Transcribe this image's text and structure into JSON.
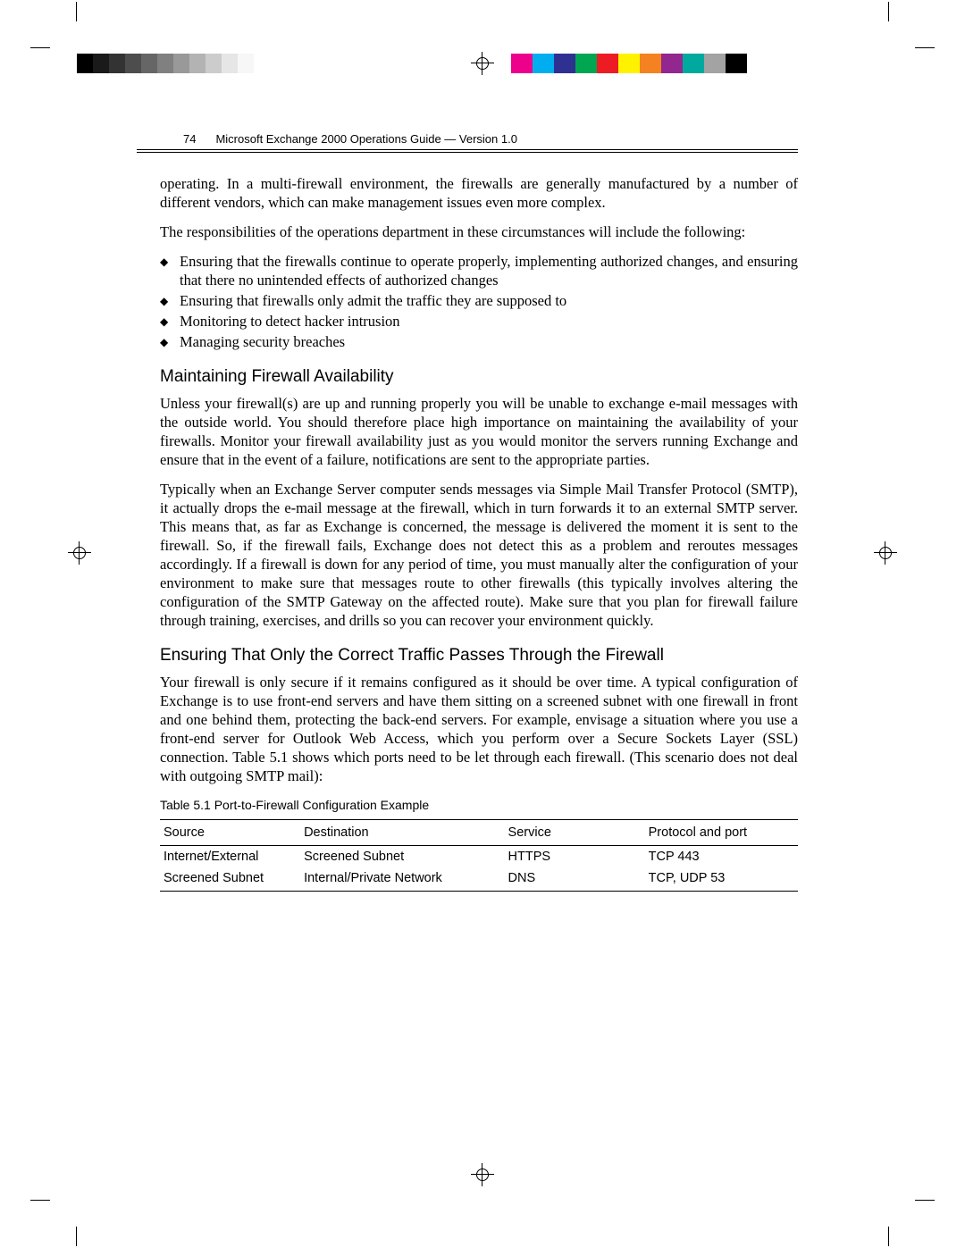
{
  "header": {
    "page_number": "74",
    "title": "Microsoft Exchange 2000 Operations Guide — Version 1.0"
  },
  "paragraphs": {
    "p1": "operating. In a multi-firewall environment, the firewalls are generally manufactured by a number of different vendors, which can make management issues even more complex.",
    "p2": "The responsibilities of the operations department in these circumstances will include the following:",
    "p3": "Unless your firewall(s) are up and running properly you will be unable to exchange e-mail messages with the outside world. You should therefore place high importance on maintaining the availability of your firewalls. Monitor your firewall availability just as you would monitor the servers running Exchange and ensure that in the event of a failure, notifications are sent to the appropriate parties.",
    "p4": "Typically when an Exchange Server computer sends messages via Simple Mail Transfer Protocol (SMTP), it actually drops the e-mail message at the firewall, which in turn forwards it to an external SMTP server. This means that, as far as Exchange is concerned, the message is delivered the moment it is sent to the firewall. So, if the firewall fails, Exchange does not detect this as a problem and reroutes messages accordingly. If a firewall is down for any period of time, you must manually alter the configuration of your environment to make sure that messages route to other firewalls (this typically involves altering the configuration of the SMTP Gateway on the affected route). Make sure that you plan for firewall failure through training, exercises, and drills so you can recover your environment quickly.",
    "p5": "Your firewall is only secure if it remains configured as it should be over time. A typical configuration of Exchange is to use front-end servers and have them sitting on a screened subnet with one firewall in front and one behind them, protecting the back-end servers. For example, envisage a situation where you use a front-end server for Outlook Web Access, which you perform over a Secure Sockets Layer (SSL) connection. Table 5.1 shows which ports need to be let through each firewall. (This scenario does not deal with outgoing SMTP mail):"
  },
  "bullets": [
    "Ensuring that the firewalls continue to operate properly, implementing authorized changes, and ensuring that there no unintended effects of authorized changes",
    "Ensuring that firewalls only admit the traffic they are supposed to",
    "Monitoring to detect hacker intrusion",
    "Managing security breaches"
  ],
  "headings": {
    "h1": "Maintaining Firewall Availability",
    "h2": "Ensuring That Only the Correct Traffic Passes Through the Firewall"
  },
  "table": {
    "caption": "Table 5.1  Port-to-Firewall Configuration Example",
    "columns": [
      "Source",
      "Destination",
      "Service",
      "Protocol and port"
    ],
    "rows": [
      [
        "Internet/External",
        "Screened Subnet",
        "HTTPS",
        "TCP 443"
      ],
      [
        "Screened Subnet",
        "Internal/Private Network",
        "DNS",
        "TCP, UDP 53"
      ]
    ]
  },
  "color_bars": {
    "greys": [
      "#000000",
      "#1a1a1a",
      "#333333",
      "#4d4d4d",
      "#666666",
      "#808080",
      "#999999",
      "#b3b3b3",
      "#cccccc",
      "#e6e6e6",
      "#f7f7f7",
      "#ffffff"
    ],
    "hues": [
      "#ec008c",
      "#00aeef",
      "#2e3192",
      "#00a651",
      "#ed1c24",
      "#fff200",
      "#f58220",
      "#92278f",
      "#00a99d",
      "#a3a3a3",
      "#000000",
      "#ffffff"
    ]
  }
}
